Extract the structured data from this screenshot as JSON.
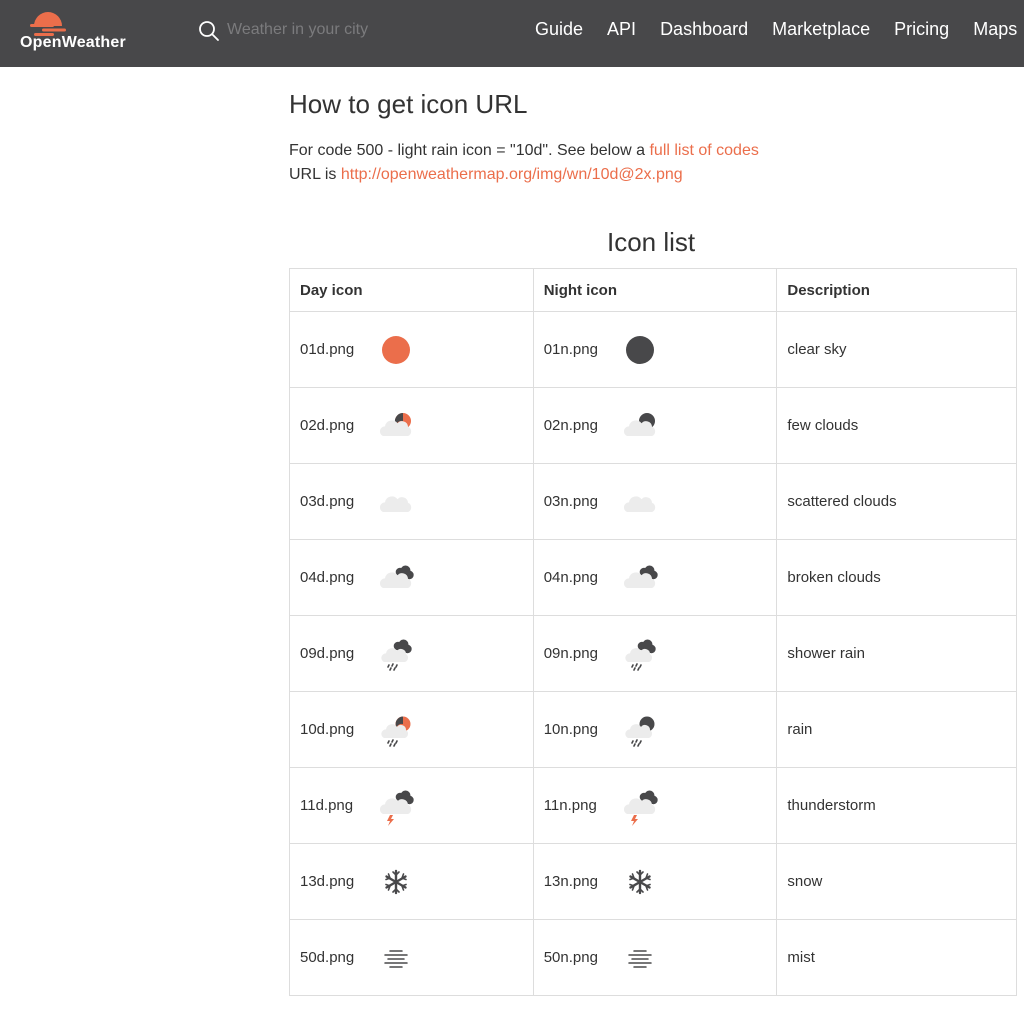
{
  "header": {
    "logo_text": "OpenWeather",
    "search_placeholder": "Weather in your city",
    "nav": [
      "Guide",
      "API",
      "Dashboard",
      "Marketplace",
      "Pricing",
      "Maps"
    ]
  },
  "main": {
    "title": "How to get icon URL",
    "line1_text": "For code 500 - light rain icon = \"10d\". See below a ",
    "line1_link": "full list of codes",
    "line2_text": "URL is ",
    "line2_link": "http://openweathermap.org/img/wn/10d@2x.png",
    "section_title": "Icon list"
  },
  "table": {
    "headers": [
      "Day icon",
      "Night icon",
      "Description"
    ],
    "rows": [
      {
        "day": "01d.png",
        "night": "01n.png",
        "desc": "clear sky",
        "day_icon": "sun-icon",
        "night_icon": "moon-icon"
      },
      {
        "day": "02d.png",
        "night": "02n.png",
        "desc": "few clouds",
        "day_icon": "few-clouds-day-icon",
        "night_icon": "few-clouds-night-icon"
      },
      {
        "day": "03d.png",
        "night": "03n.png",
        "desc": "scattered clouds",
        "day_icon": "cloud-icon",
        "night_icon": "cloud-icon"
      },
      {
        "day": "04d.png",
        "night": "04n.png",
        "desc": "broken clouds",
        "day_icon": "broken-clouds-icon",
        "night_icon": "broken-clouds-icon"
      },
      {
        "day": "09d.png",
        "night": "09n.png",
        "desc": "shower rain",
        "day_icon": "shower-rain-icon",
        "night_icon": "shower-rain-icon"
      },
      {
        "day": "10d.png",
        "night": "10n.png",
        "desc": "rain",
        "day_icon": "rain-day-icon",
        "night_icon": "rain-night-icon"
      },
      {
        "day": "11d.png",
        "night": "11n.png",
        "desc": "thunderstorm",
        "day_icon": "thunderstorm-icon",
        "night_icon": "thunderstorm-icon"
      },
      {
        "day": "13d.png",
        "night": "13n.png",
        "desc": "snow",
        "day_icon": "snowflake-icon",
        "night_icon": "snowflake-icon"
      },
      {
        "day": "50d.png",
        "night": "50n.png",
        "desc": "mist",
        "day_icon": "mist-icon",
        "night_icon": "mist-icon"
      }
    ]
  },
  "colors": {
    "header_bg": "#48484a",
    "accent": "#eb6e4b",
    "moon": "#48484a",
    "cloud": "#ececec"
  }
}
